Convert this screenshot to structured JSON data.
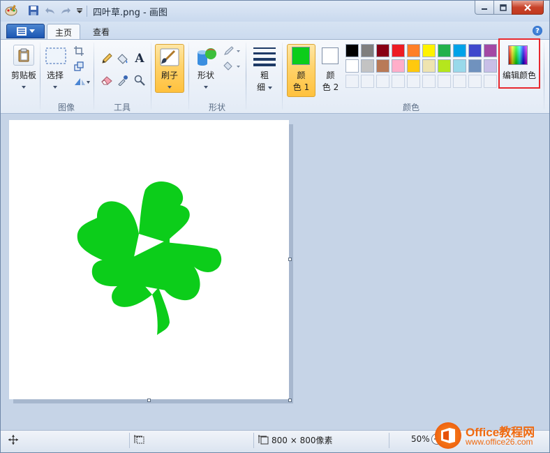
{
  "window": {
    "title": "四叶草.png - 画图"
  },
  "ribbon": {
    "tabs": [
      {
        "label": "主页"
      },
      {
        "label": "查看"
      }
    ],
    "clipboard": {
      "label": "剪贴板"
    },
    "image": {
      "select_label": "选择",
      "group_label": "图像"
    },
    "tools": {
      "group_label": "工具"
    },
    "brushes": {
      "label": "刷子"
    },
    "shapes": {
      "label": "形状",
      "group_label": "形状"
    },
    "size": {
      "label_line1": "粗",
      "label_line2": "细"
    },
    "colors": {
      "color1_line1": "颜",
      "color1_line2": "色 1",
      "color2_line1": "颜",
      "color2_line2": "色 2",
      "color1_value": "#0ccd1a",
      "color2_value": "#ffffff",
      "group_label": "颜色",
      "edit_label": "编辑颜色",
      "palette_row1": [
        "#000000",
        "#7f7f7f",
        "#880015",
        "#ed1c24",
        "#ff7f27",
        "#fff200",
        "#22b14c",
        "#00a2e8",
        "#3f48cc",
        "#a349a4"
      ],
      "palette_row2": [
        "#ffffff",
        "#c3c3c3",
        "#b97a57",
        "#ffaec9",
        "#ffc90e",
        "#efe4b0",
        "#b5e61d",
        "#99d9ea",
        "#7092be",
        "#c8bfe7"
      ]
    }
  },
  "canvas": {
    "shape_color": "#0ccd1a"
  },
  "statusbar": {
    "image_size": "800 × 800像素",
    "zoom": "50%"
  },
  "watermark": {
    "title": "Office教程网",
    "url": "www.office26.com"
  }
}
